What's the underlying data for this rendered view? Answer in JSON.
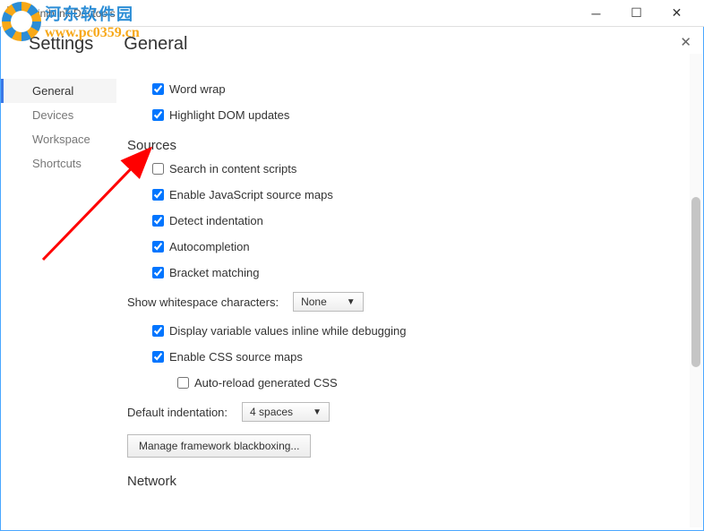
{
  "window": {
    "title": "Miniblink Devtools"
  },
  "watermark": {
    "chinese": "河东软件园",
    "url": "www.pc0359.cn"
  },
  "panel": {
    "title": "Settings",
    "section": "General"
  },
  "sidebar": {
    "items": [
      {
        "label": "General",
        "active": true
      },
      {
        "label": "Devices",
        "active": false
      },
      {
        "label": "Workspace",
        "active": false
      },
      {
        "label": "Shortcuts",
        "active": false
      }
    ]
  },
  "settings": {
    "word_wrap": {
      "label": "Word wrap",
      "checked": true
    },
    "highlight_dom": {
      "label": "Highlight DOM updates",
      "checked": true
    },
    "sources_header": "Sources",
    "search_content_scripts": {
      "label": "Search in content scripts",
      "checked": false
    },
    "enable_js_maps": {
      "label": "Enable JavaScript source maps",
      "checked": true
    },
    "detect_indent": {
      "label": "Detect indentation",
      "checked": true
    },
    "autocomplete": {
      "label": "Autocompletion",
      "checked": true
    },
    "bracket_match": {
      "label": "Bracket matching",
      "checked": true
    },
    "whitespace_label": "Show whitespace characters:",
    "whitespace_value": "None",
    "display_inline": {
      "label": "Display variable values inline while debugging",
      "checked": true
    },
    "enable_css_maps": {
      "label": "Enable CSS source maps",
      "checked": true
    },
    "auto_reload_css": {
      "label": "Auto-reload generated CSS",
      "checked": false
    },
    "default_indent_label": "Default indentation:",
    "default_indent_value": "4 spaces",
    "blackbox_btn": "Manage framework blackboxing...",
    "network_header": "Network"
  }
}
